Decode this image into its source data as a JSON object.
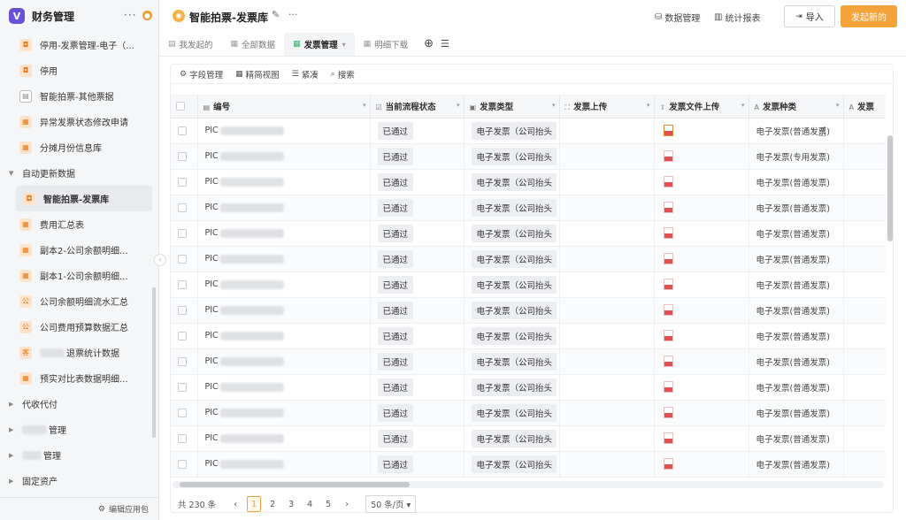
{
  "sidebar": {
    "app_title": "财务管理",
    "app_logo": "V",
    "items_top": [
      {
        "label": "停用-发票管理-电子（...",
        "icon": "camera-icon"
      },
      {
        "label": "停用",
        "icon": "camera-icon"
      },
      {
        "label": "智能拍票-其他票据",
        "icon": "document-icon"
      },
      {
        "label": "异常发票状态修改申请",
        "icon": "form-icon"
      },
      {
        "label": "分摊月份信息库",
        "icon": "form-icon"
      }
    ],
    "group_auto": "自动更新数据",
    "items_auto": [
      {
        "label": "智能拍票-发票库",
        "icon": "camera-icon",
        "active": true
      },
      {
        "label": "费用汇总表",
        "icon": "form-icon"
      },
      {
        "label": "副本2-公司余额明细...",
        "icon": "form-icon"
      },
      {
        "label": "副本1-公司余额明细...",
        "icon": "form-icon"
      },
      {
        "label": "公司余额明细流水汇总",
        "icon": "form-icon",
        "glyph": "公"
      },
      {
        "label": "公司费用预算数据汇总",
        "icon": "form-icon",
        "glyph": "公"
      },
      {
        "label": "退票统计数据",
        "icon": "form-icon",
        "glyph": "客"
      },
      {
        "label": "预实对比表数据明细...",
        "icon": "form-icon"
      }
    ],
    "groups_bottom": [
      "代收代付",
      "管理",
      "管理",
      "固定资产"
    ],
    "footer": "编辑应用包"
  },
  "header": {
    "title": "智能拍票-发票库",
    "buttons": {
      "data_manage": "数据管理",
      "stats": "统计报表",
      "import": "导入",
      "new": "发起新的"
    }
  },
  "tabs": [
    {
      "label": "我发起的",
      "icon": "list-icon"
    },
    {
      "label": "全部数据",
      "icon": "table-icon"
    },
    {
      "label": "发票管理",
      "icon": "table-icon",
      "active": true
    },
    {
      "label": "明细下载",
      "icon": "table-icon"
    }
  ],
  "toolbar": {
    "fields": "字段管理",
    "view": "精简视图",
    "compact": "紧凑",
    "search": "搜索"
  },
  "table": {
    "columns": [
      "编号",
      "当前流程状态",
      "发票类型",
      "发票上传",
      "发票文件上传",
      "发票种类",
      "发票"
    ],
    "rows": [
      {
        "id": "PIC",
        "status": "已通过",
        "type": "电子发票（公司抬头",
        "kind": "电子发票(普通发票)"
      },
      {
        "id": "PIC",
        "status": "已通过",
        "type": "电子发票（公司抬头",
        "kind": "电子发票(专用发票)"
      },
      {
        "id": "PIC",
        "status": "已通过",
        "type": "电子发票（公司抬头",
        "kind": "电子发票(普通发票)"
      },
      {
        "id": "PIC",
        "status": "已通过",
        "type": "电子发票（公司抬头",
        "kind": "电子发票(普通发票)"
      },
      {
        "id": "PIC",
        "status": "已通过",
        "type": "电子发票（公司抬头",
        "kind": "电子发票(普通发票)"
      },
      {
        "id": "PIC",
        "status": "已通过",
        "type": "电子发票（公司抬头",
        "kind": "电子发票(普通发票)"
      },
      {
        "id": "PIC",
        "status": "已通过",
        "type": "电子发票（公司抬头",
        "kind": "电子发票(普通发票)"
      },
      {
        "id": "PIC",
        "status": "已通过",
        "type": "电子发票（公司抬头",
        "kind": "电子发票(普通发票)"
      },
      {
        "id": "PIC",
        "status": "已通过",
        "type": "电子发票（公司抬头",
        "kind": "电子发票(普通发票)"
      },
      {
        "id": "PIC",
        "status": "已通过",
        "type": "电子发票（公司抬头",
        "kind": "电子发票(普通发票)"
      },
      {
        "id": "PIC",
        "status": "已通过",
        "type": "电子发票（公司抬头",
        "kind": "电子发票(普通发票)"
      },
      {
        "id": "PIC",
        "status": "已通过",
        "type": "电子发票（公司抬头",
        "kind": "电子发票(普通发票)"
      },
      {
        "id": "PIC",
        "status": "已通过",
        "type": "电子发票（公司抬头",
        "kind": "电子发票(普通发票)"
      },
      {
        "id": "PIC",
        "status": "已通过",
        "type": "电子发票（公司抬头",
        "kind": "电子发票(普通发票)"
      }
    ]
  },
  "pager": {
    "total": "共 230 条",
    "pages": [
      "1",
      "2",
      "3",
      "4",
      "5"
    ],
    "current": "1",
    "size": "50 条/页"
  },
  "colors": {
    "accent": "#f4a23a",
    "brand": "#6a4fd8"
  }
}
